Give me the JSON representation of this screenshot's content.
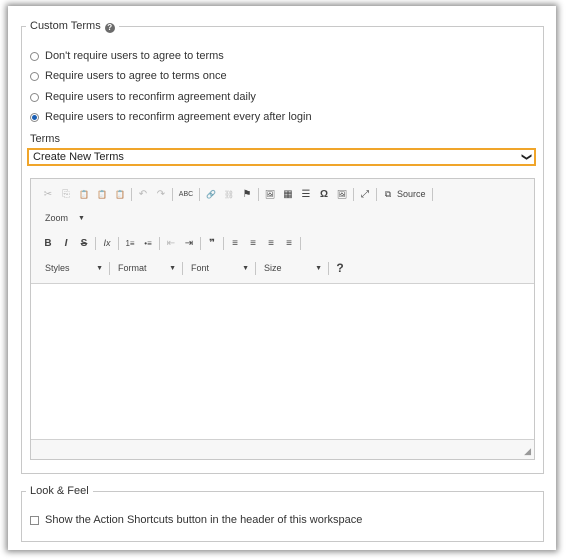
{
  "custom_terms": {
    "legend": "Custom Terms",
    "help_icon": "?",
    "options": [
      {
        "label": "Don't require users to agree to terms",
        "checked": false
      },
      {
        "label": "Require users to agree to terms once",
        "checked": false
      },
      {
        "label": "Require users to reconfirm agreement daily",
        "checked": false
      },
      {
        "label": "Require users to reconfirm agreement every after login",
        "checked": true
      }
    ],
    "terms_label": "Terms",
    "terms_selected": "Create New Terms",
    "terms_chevron": "❯"
  },
  "editor": {
    "toolbar_row1": [
      "✂",
      "⎘",
      "📋",
      "📋",
      "📋",
      "↶",
      "↷",
      "ABC",
      "🔗",
      "⛓",
      "⚑",
      "🖼",
      "▦",
      "☰",
      "Ω",
      "🖼",
      "⤢",
      "⧉"
    ],
    "source_label": "Source",
    "zoom_label": "Zoom",
    "row3": {
      "bold": "B",
      "italic": "I",
      "strike": "S",
      "clear": "Ix",
      "ol": "1≡",
      "ul": "•≡",
      "outdent": "⇤",
      "indent": "⇥",
      "quote": "❞",
      "left": "≡",
      "center": "≡",
      "right": "≡",
      "justify": "≡"
    },
    "styles_label": "Styles",
    "format_label": "Format",
    "font_label": "Font",
    "size_label": "Size",
    "help_label": "?",
    "resize_glyph": "◢"
  },
  "look_feel": {
    "legend": "Look & Feel",
    "shortcuts_label": "Show the Action Shortcuts button in the header of this workspace",
    "shortcuts_checked": false
  },
  "colors": {
    "accent": "#f0a52a",
    "radio_checked": "#1a5fb4"
  }
}
